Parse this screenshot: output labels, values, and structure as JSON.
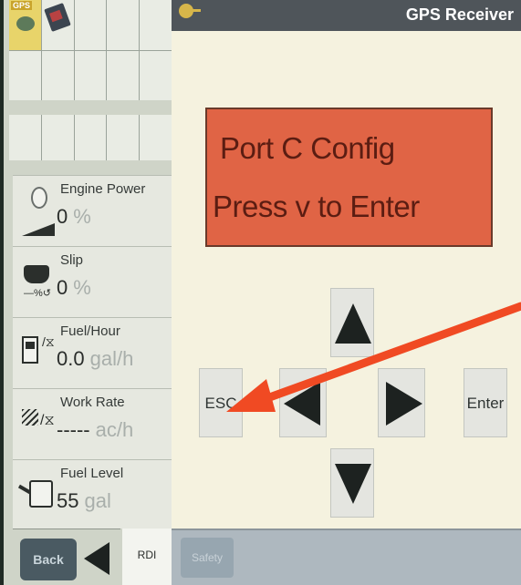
{
  "header": {
    "title": "GPS Receiver"
  },
  "shortcuts": {
    "gps_tag": "GPS"
  },
  "gauges": {
    "engine_power": {
      "title": "Engine Power",
      "value": "0",
      "unit": "%"
    },
    "slip": {
      "title": "Slip",
      "value": "0",
      "unit": "%"
    },
    "fuel_hour": {
      "title": "Fuel/Hour",
      "value": "0.0",
      "unit": "gal/h"
    },
    "work_rate": {
      "title": "Work Rate",
      "value": "-----",
      "unit": "ac/h"
    },
    "fuel_level": {
      "title": "Fuel Level",
      "value": "55",
      "unit": "gal"
    }
  },
  "lcd": {
    "line1": "Port C Config",
    "line2": "Press v to Enter"
  },
  "keys": {
    "esc": "ESC",
    "enter": "Enter"
  },
  "bottom": {
    "back": "Back",
    "rdi": "RDI",
    "safety": "Safety"
  },
  "colors": {
    "lcd": "#e06445",
    "annotation_arrow": "#f04a23",
    "header": "#4f555a"
  }
}
